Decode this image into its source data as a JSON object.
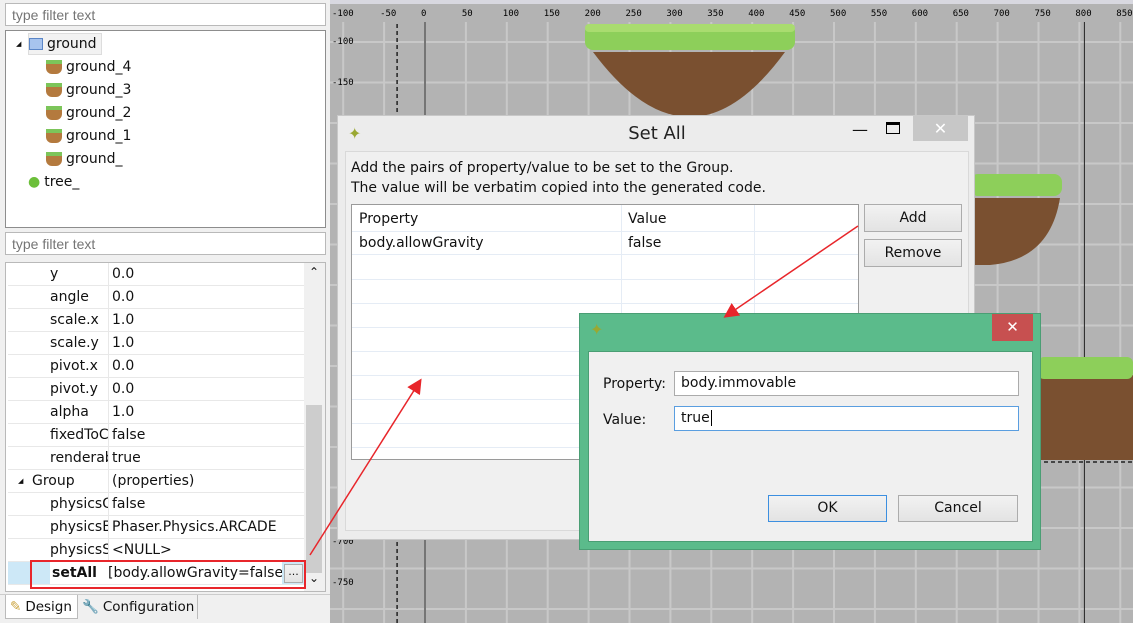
{
  "outline": {
    "filter_placeholder": "type filter text",
    "tree": [
      {
        "label": "ground",
        "icon": "group-icon",
        "level": 0
      },
      {
        "label": "ground_4",
        "icon": "ground-sprite-icon",
        "level": 1
      },
      {
        "label": "ground_3",
        "icon": "ground-sprite-icon",
        "level": 1
      },
      {
        "label": "ground_2",
        "icon": "ground-sprite-icon",
        "level": 1
      },
      {
        "label": "ground_1",
        "icon": "ground-sprite-icon",
        "level": 1
      },
      {
        "label": "ground_",
        "icon": "ground-sprite-icon",
        "level": 1
      },
      {
        "label": "tree_",
        "icon": "tree-icon",
        "level": 0
      }
    ]
  },
  "properties": {
    "filter_placeholder": "type filter text",
    "rows": [
      {
        "name": "y",
        "value": "0.0"
      },
      {
        "name": "angle",
        "value": "0.0"
      },
      {
        "name": "scale.x",
        "value": "1.0"
      },
      {
        "name": "scale.y",
        "value": "1.0"
      },
      {
        "name": "pivot.x",
        "value": "0.0"
      },
      {
        "name": "pivot.y",
        "value": "0.0"
      },
      {
        "name": "alpha",
        "value": "1.0"
      },
      {
        "name": "fixedToCamera",
        "value": "false"
      },
      {
        "name": "renderable",
        "value": "true"
      },
      {
        "name": "Group",
        "value": "(properties)",
        "category": true
      },
      {
        "name": "physicsGroup",
        "value": "false"
      },
      {
        "name": "physicsBodyType",
        "value": "Phaser.Physics.ARCADE"
      },
      {
        "name": "physicsSortDirection",
        "value": "<NULL>"
      },
      {
        "name": "setAll",
        "value": "[body.allowGravity=false,body.immovable=true]",
        "selected": true
      }
    ],
    "ellipsis": "..."
  },
  "bottom_tabs": [
    {
      "label": "Design",
      "icon": "design-icon"
    },
    {
      "label": "Configuration",
      "icon": "wrench-icon"
    }
  ],
  "ruler": {
    "x_ticks": [
      "-100",
      "-50",
      "0",
      "50",
      "100",
      "150",
      "200",
      "250",
      "300",
      "350",
      "400",
      "450",
      "500",
      "550",
      "600",
      "650",
      "700",
      "750",
      "800",
      "850"
    ],
    "y_ticks": [
      "-100",
      "-150",
      "-700",
      "-750"
    ]
  },
  "setall_dialog": {
    "title": "Set All",
    "description_1": "Add the pairs of property/value to be set to the Group.",
    "description_2": "The value will be verbatim copied into the generated code.",
    "columns": [
      "Property",
      "Value"
    ],
    "rows": [
      {
        "property": "body.allowGravity",
        "value": "false"
      }
    ],
    "add_label": "Add",
    "remove_label": "Remove"
  },
  "pair_dialog": {
    "property_label": "Property:",
    "property_value": "body.immovable",
    "value_label": "Value:",
    "value_value": "true",
    "ok_label": "OK",
    "cancel_label": "Cancel",
    "accent": "#5bbb8b",
    "close_color": "#c75050"
  },
  "annotation_color": "#e8262b"
}
